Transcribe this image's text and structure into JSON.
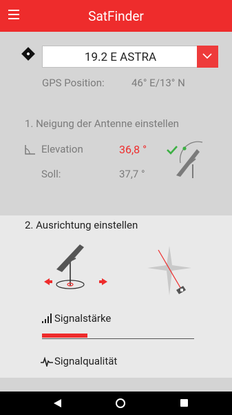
{
  "appbar": {
    "title": "SatFinder"
  },
  "satellite": {
    "selected": "19.2 E ASTRA"
  },
  "gps": {
    "label": "GPS Position:",
    "value": "46° E/13° N"
  },
  "section1": {
    "title": "1. Neigung der Antenne einstellen",
    "elevation_label": "Elevation",
    "elevation_value": "36,8 °",
    "soll_label": "Soll:",
    "soll_value": "37,7 °"
  },
  "section2": {
    "title": "2. Ausrichtung einstellen",
    "signal_strength_label": "Signalstärke",
    "signal_strength_level": 0.3,
    "signal_quality_label": "Signalqualität"
  },
  "colors": {
    "accent": "#ee2c2c",
    "check": "#3cb043"
  }
}
